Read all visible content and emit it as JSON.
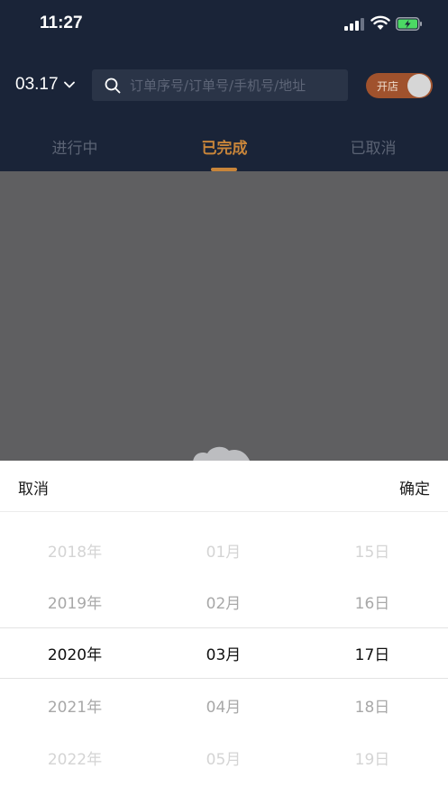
{
  "status_bar": {
    "time": "11:27"
  },
  "header": {
    "date": "03.17",
    "search_placeholder": "订单序号/订单号/手机号/地址",
    "store_toggle_label": "开店",
    "tabs": [
      {
        "label": "进行中"
      },
      {
        "label": "已完成"
      },
      {
        "label": "已取消"
      }
    ],
    "active_tab": 1
  },
  "colors": {
    "header_bg": "#1a2438",
    "accent": "#c8853a",
    "toggle_bg": "#a0522d",
    "battery_green": "#4cd964"
  },
  "date_picker": {
    "cancel_label": "取消",
    "confirm_label": "确定",
    "years": [
      "2018年",
      "2019年",
      "2020年",
      "2021年",
      "2022年"
    ],
    "months": [
      "01月",
      "02月",
      "03月",
      "04月",
      "05月"
    ],
    "days": [
      "15日",
      "16日",
      "17日",
      "18日",
      "19日"
    ],
    "selected": {
      "year": "2020年",
      "month": "03月",
      "day": "17日"
    }
  },
  "icons": {
    "chevron": "chevron-down-icon",
    "search": "search-icon",
    "signal": "cellular-signal-icon",
    "wifi": "wifi-icon",
    "battery": "battery-charging-icon"
  }
}
